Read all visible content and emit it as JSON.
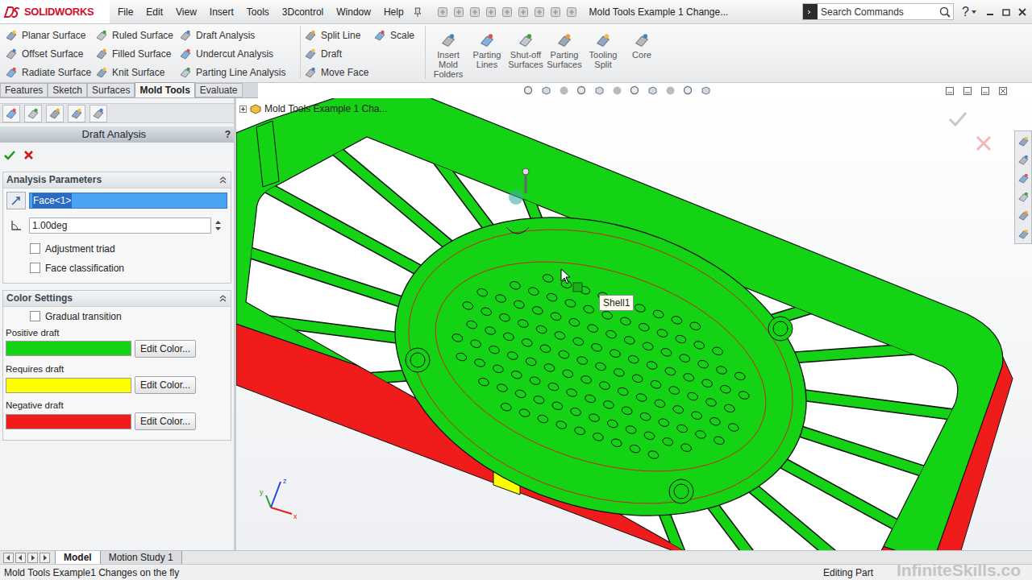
{
  "app": {
    "logo": "SOLIDWORKS"
  },
  "menu": [
    "File",
    "Edit",
    "View",
    "Insert",
    "Tools",
    "3Dcontrol",
    "Window",
    "Help"
  ],
  "document_title": "Mold Tools Example 1 Change...",
  "search": {
    "placeholder": "Search Commands"
  },
  "help_button": "?",
  "ribbon": {
    "columns": [
      [
        "Planar Surface",
        "Offset Surface",
        "Radiate Surface"
      ],
      [
        "Ruled Surface",
        "Filled Surface",
        "Knit Surface"
      ],
      [
        "Draft Analysis",
        "Undercut Analysis",
        "Parting Line Analysis"
      ],
      [
        "Split Line",
        "Draft",
        "Move Face"
      ],
      [
        "Scale"
      ]
    ],
    "large_buttons": [
      "Insert Mold Folders",
      "Parting Lines",
      "Shut-off Surfaces",
      "Parting Surfaces",
      "Tooling Split",
      "Core"
    ]
  },
  "tabs": [
    {
      "label": "Features",
      "selected": false
    },
    {
      "label": "Sketch",
      "selected": false
    },
    {
      "label": "Surfaces",
      "selected": false
    },
    {
      "label": "Mold Tools",
      "selected": true
    },
    {
      "label": "Evaluate",
      "selected": false
    }
  ],
  "property_manager": {
    "title": "Draft Analysis",
    "help": "?",
    "analysis_parameters": {
      "title": "Analysis Parameters",
      "face_field": {
        "value": "Face<1>",
        "selected": true
      },
      "angle_field": {
        "value": "1.00deg"
      },
      "checkboxes": [
        {
          "label": "Adjustment triad",
          "checked": false
        },
        {
          "label": "Face classification",
          "checked": false
        }
      ]
    },
    "color_settings": {
      "title": "Color Settings",
      "checkbox": {
        "label": "Gradual transition",
        "checked": false
      },
      "swatches": [
        {
          "label": "Positive draft",
          "color": "#14d214",
          "button": "Edit Color..."
        },
        {
          "label": "Requires draft",
          "color": "#ffff00",
          "button": "Edit Color..."
        },
        {
          "label": "Negative draft",
          "color": "#f01c1c",
          "button": "Edit Color..."
        }
      ]
    }
  },
  "viewport": {
    "tree_label": "Mold Tools Example 1 Cha...",
    "tooltip": "Shell1",
    "triad": [
      {
        "label": "x",
        "color": "#e02020"
      },
      {
        "label": "y",
        "color": "#20a020"
      },
      {
        "label": "z",
        "color": "#2040e0"
      }
    ],
    "watermark": "InfiniteSkills.co"
  },
  "bottom_tabs": [
    {
      "label": "Model",
      "selected": true
    },
    {
      "label": "Motion Study 1",
      "selected": false
    }
  ],
  "status_bar": {
    "left": "Mold Tools Example1 Changes on the fly",
    "right": "Editing Part"
  }
}
